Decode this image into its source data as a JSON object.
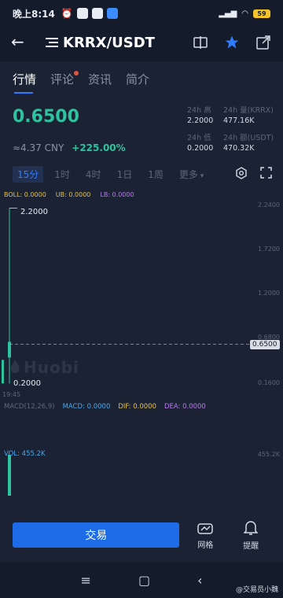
{
  "status_bar": {
    "time": "晚上8:14",
    "battery": "59"
  },
  "header": {
    "pair": "KRRX/USDT"
  },
  "tabs": [
    {
      "label": "行情"
    },
    {
      "label": "评论"
    },
    {
      "label": "资讯"
    },
    {
      "label": "简介"
    }
  ],
  "ticker": {
    "last_price": "0.6500",
    "cny": "≈4.37 CNY",
    "change": "+225.00%",
    "high_label": "24h 高",
    "high": "2.2000",
    "low_label": "24h 低",
    "low": "0.2000",
    "vol_label": "24h 量(KRRX)",
    "vol": "477.16K",
    "amount_label": "24h 额(USDT)",
    "amount": "470.32K"
  },
  "periods": [
    "15分",
    "1时",
    "4时",
    "1日",
    "1周",
    "更多"
  ],
  "indicators": {
    "boll": "BOLL: 0.0000",
    "ub": "UB: 0.0000",
    "lb": "LB: 0.0000",
    "macd_params": "MACD(12,26,9)",
    "macd": "MACD: 0.0000",
    "dif": "DIF: 0.0000",
    "dea": "DEA: 0.0000",
    "vol": "VOL: 455.2K"
  },
  "chart_labels": {
    "high_marker": "2.2000",
    "low_marker": "0.2000",
    "current_price": "0.6500",
    "time": "19:45",
    "watermark": "Huobi"
  },
  "y_axis": [
    "2.2400",
    "1.7200",
    "1.2000",
    "0.6800",
    "0.1600"
  ],
  "vol_axis": "455.2K",
  "bottom": {
    "trade": "交易",
    "grid": "网格",
    "alert": "提醒"
  },
  "credit": "@交易员小魏",
  "colors": {
    "up": "#2ec39e",
    "accent": "#1e6be8",
    "bg": "#1a2233"
  },
  "chart_data": {
    "type": "candlestick",
    "candles": [
      {
        "time": "19:45",
        "high": 2.2,
        "low": 0.2,
        "close": 0.65
      }
    ],
    "ylim": [
      0.16,
      2.24
    ],
    "volume": [
      455.2
    ]
  }
}
